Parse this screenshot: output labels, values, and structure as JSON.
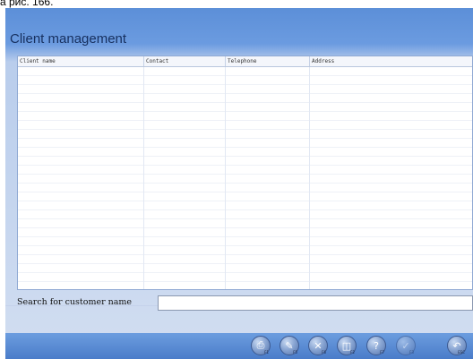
{
  "caption": "а рис. 166.",
  "window": {
    "title": "Client management"
  },
  "table": {
    "columns": [
      "Client name",
      "Contact",
      "Telephone",
      "Address"
    ],
    "rows": []
  },
  "search": {
    "label": "Search for customer name",
    "value": "",
    "placeholder": ""
  },
  "toolbar": {
    "buttons": [
      {
        "icon": "print-icon",
        "key": "F1"
      },
      {
        "icon": "edit-icon",
        "key": "F5"
      },
      {
        "icon": "delete-icon",
        "key": "F6"
      },
      {
        "icon": "save-icon",
        "key": "F2"
      },
      {
        "icon": "help-icon",
        "key": "F7"
      },
      {
        "icon": "confirm-icon",
        "key": "F3"
      },
      {
        "icon": "exit-icon",
        "key": "ESC"
      }
    ]
  }
}
